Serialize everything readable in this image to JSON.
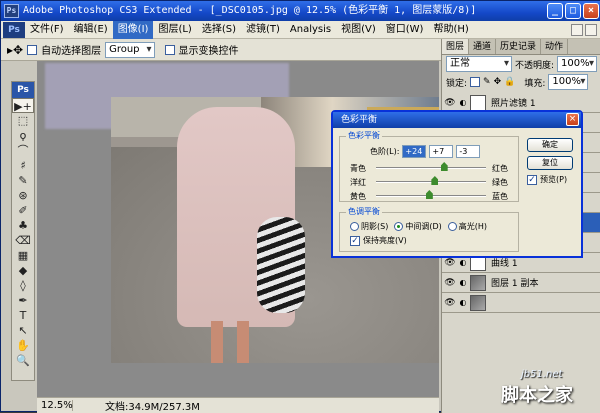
{
  "window": {
    "title": "Adobe Photoshop CS3 Extended - [_DSC0105.jpg @ 12.5% (色彩平衡 1, 图层蒙版/8)]",
    "app_badge": "Ps",
    "controls": [
      "_",
      "□",
      "×"
    ]
  },
  "menubar": {
    "logo": "Ps",
    "items": [
      "文件(F)",
      "编辑(E)",
      "图像(I)",
      "图层(L)",
      "选择(S)",
      "滤镜(T)",
      "Analysis",
      "视图(V)",
      "窗口(W)",
      "帮助(H)"
    ],
    "active_index": 2
  },
  "optionsbar": {
    "auto_select_label": "自动选择图层",
    "auto_select_checked": false,
    "group_select_value": "Group",
    "show_transform_label": "显示变换控件",
    "show_transform_checked": false
  },
  "toolbox": {
    "badge": "Ps",
    "tools": [
      "▶+",
      "⬚",
      "ϙ",
      "⌒",
      "♯",
      "✎",
      "⊛",
      "✐",
      "♣",
      "⌫",
      "▦",
      "◆",
      "◊",
      "✒",
      "T",
      "↖",
      "✋",
      "🔍"
    ]
  },
  "statusbar": {
    "zoom": "12.5%",
    "doc": "文档:34.9M/257.3M"
  },
  "panel": {
    "tabs": [
      "图层",
      "通道",
      "历史记录",
      "动作"
    ],
    "blend_mode": "正常",
    "opacity_label": "不透明度:",
    "opacity": "100%",
    "lock_label": "锁定:",
    "fill_label": "填充:",
    "fill": "100%",
    "layers": [
      {
        "name": "照片滤镜 1",
        "thumb": "light",
        "selected": false
      },
      {
        "name": "",
        "thumb": "light",
        "selected": false
      },
      {
        "name": "",
        "thumb": "light",
        "selected": false
      },
      {
        "name": "",
        "thumb": "light",
        "selected": false
      },
      {
        "name": "",
        "thumb": "light",
        "selected": false
      },
      {
        "name": "",
        "thumb": "light",
        "selected": false
      },
      {
        "name": "色彩平衡 1",
        "thumb": "light",
        "selected": true
      },
      {
        "name": "选取颜色 1",
        "thumb": "light",
        "selected": false
      },
      {
        "name": "曲线 1",
        "thumb": "light",
        "selected": false
      },
      {
        "name": "图层 1 副本",
        "thumb": "dark",
        "selected": false
      },
      {
        "name": "",
        "thumb": "dark",
        "selected": false
      }
    ]
  },
  "dialog": {
    "title": "色彩平衡",
    "balance_group": "色彩平衡",
    "levels_label": "色阶(L):",
    "levels": [
      "+24",
      "+7",
      "-3"
    ],
    "sliders": [
      {
        "left": "青色",
        "right": "红色",
        "value": 24
      },
      {
        "left": "洋红",
        "right": "绿色",
        "value": 7
      },
      {
        "left": "黄色",
        "right": "蓝色",
        "value": -3
      }
    ],
    "tone_group": "色调平衡",
    "tones": [
      {
        "label": "阴影(S)",
        "checked": false
      },
      {
        "label": "中间调(D)",
        "checked": true
      },
      {
        "label": "高光(H)",
        "checked": false
      }
    ],
    "preserve_label": "保持亮度(V)",
    "preserve_checked": true,
    "ok_label": "确定",
    "reset_label": "复位",
    "preview_label": "预览(P)",
    "preview_checked": true
  },
  "watermark": {
    "site": "jb51.net",
    "name": "脚本之家"
  }
}
